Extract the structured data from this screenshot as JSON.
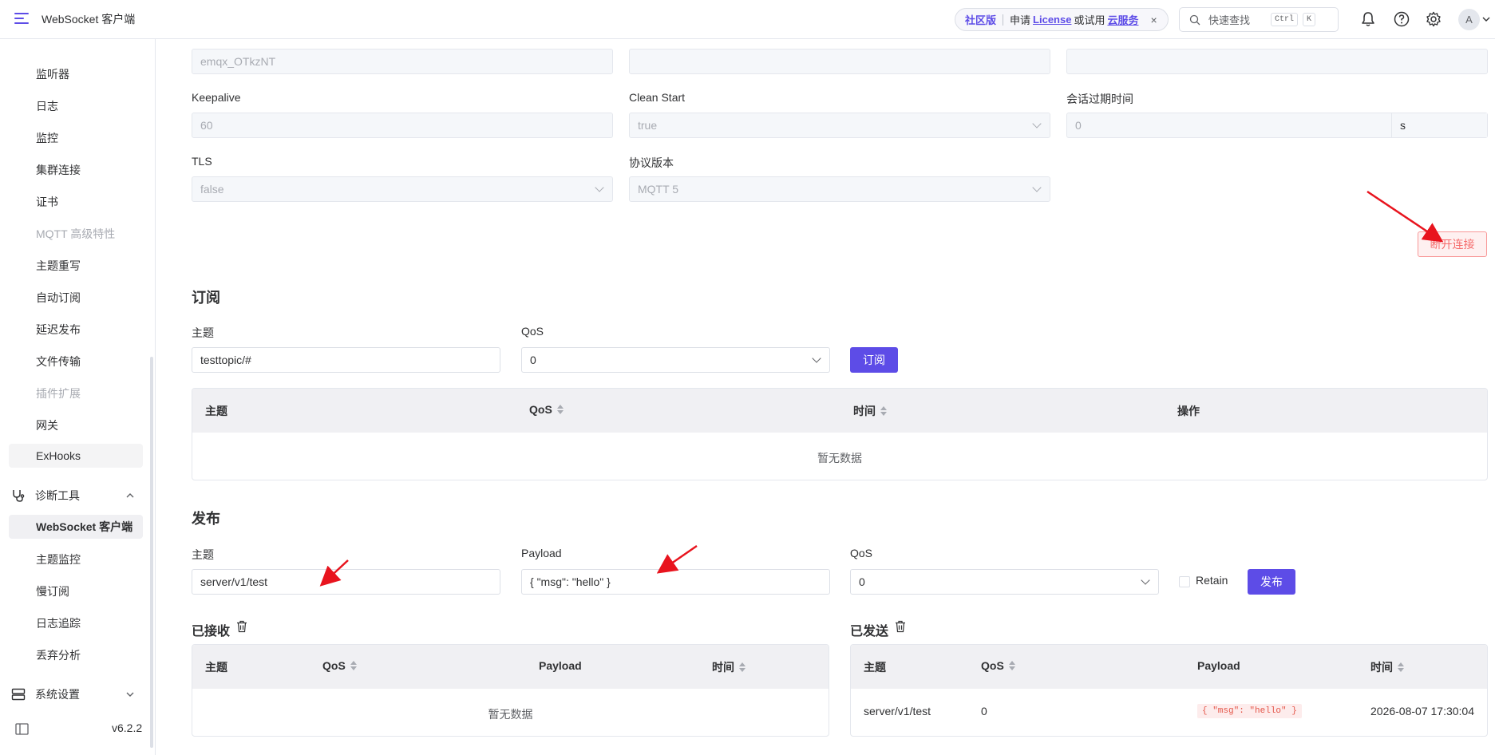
{
  "header": {
    "app_title": "WebSocket 客户端",
    "edition": "社区版",
    "apply_text": "申请",
    "license_link": "License",
    "or_try": "或试用",
    "cloud_link": "云服务",
    "close": "×",
    "search_placeholder": "快速查找",
    "kbd_ctrl": "Ctrl",
    "kbd_k": "K",
    "avatar": "A"
  },
  "sidebar": {
    "items": [
      {
        "label": "监听器"
      },
      {
        "label": "日志"
      },
      {
        "label": "监控"
      },
      {
        "label": "集群连接"
      },
      {
        "label": "证书"
      },
      {
        "label": "MQTT 高级特性"
      },
      {
        "label": "主题重写"
      },
      {
        "label": "自动订阅"
      },
      {
        "label": "延迟发布"
      },
      {
        "label": "文件传输"
      },
      {
        "label": "插件扩展"
      },
      {
        "label": "网关"
      },
      {
        "label": "ExHooks"
      }
    ],
    "diag_group": "诊断工具",
    "diag_items": [
      {
        "label": "WebSocket 客户端"
      },
      {
        "label": "主题监控"
      },
      {
        "label": "慢订阅"
      },
      {
        "label": "日志追踪"
      },
      {
        "label": "丢弃分析"
      }
    ],
    "settings_group": "系统设置",
    "version": "v6.2.2"
  },
  "connection": {
    "client_id_value": "emqx_OTkzNT",
    "keepalive_label": "Keepalive",
    "keepalive_value": "60",
    "clean_start_label": "Clean Start",
    "clean_start_value": "true",
    "session_expiry_label": "会话过期时间",
    "session_expiry_value": "0",
    "session_expiry_unit": "s",
    "tls_label": "TLS",
    "tls_value": "false",
    "protocol_label": "协议版本",
    "protocol_value": "MQTT 5",
    "disconnect_button": "断开连接"
  },
  "subscribe": {
    "title": "订阅",
    "topic_label": "主题",
    "topic_value": "testtopic/#",
    "qos_label": "QoS",
    "qos_value": "0",
    "button": "订阅",
    "table_headers": [
      "主题",
      "QoS",
      "时间",
      "操作"
    ],
    "empty": "暂无数据"
  },
  "publish": {
    "title": "发布",
    "topic_label": "主题",
    "topic_value": "server/v1/test",
    "payload_label": "Payload",
    "payload_value": "{ \"msg\": \"hello\" }",
    "qos_label": "QoS",
    "qos_value": "0",
    "retain_label": "Retain",
    "button": "发布"
  },
  "received": {
    "title": "已接收",
    "headers": [
      "主题",
      "QoS",
      "Payload",
      "时间"
    ],
    "empty": "暂无数据"
  },
  "sent": {
    "title": "已发送",
    "headers": [
      "主题",
      "QoS",
      "Payload",
      "时间"
    ],
    "rows": [
      {
        "topic": "server/v1/test",
        "qos": "0",
        "payload": "{ \"msg\": \"hello\" }",
        "time": "2026-08-07 17:30:04"
      }
    ]
  },
  "colors": {
    "accent": "#5d4ce7",
    "danger": "#f56c6c",
    "annotation_arrow": "#e8141e"
  }
}
